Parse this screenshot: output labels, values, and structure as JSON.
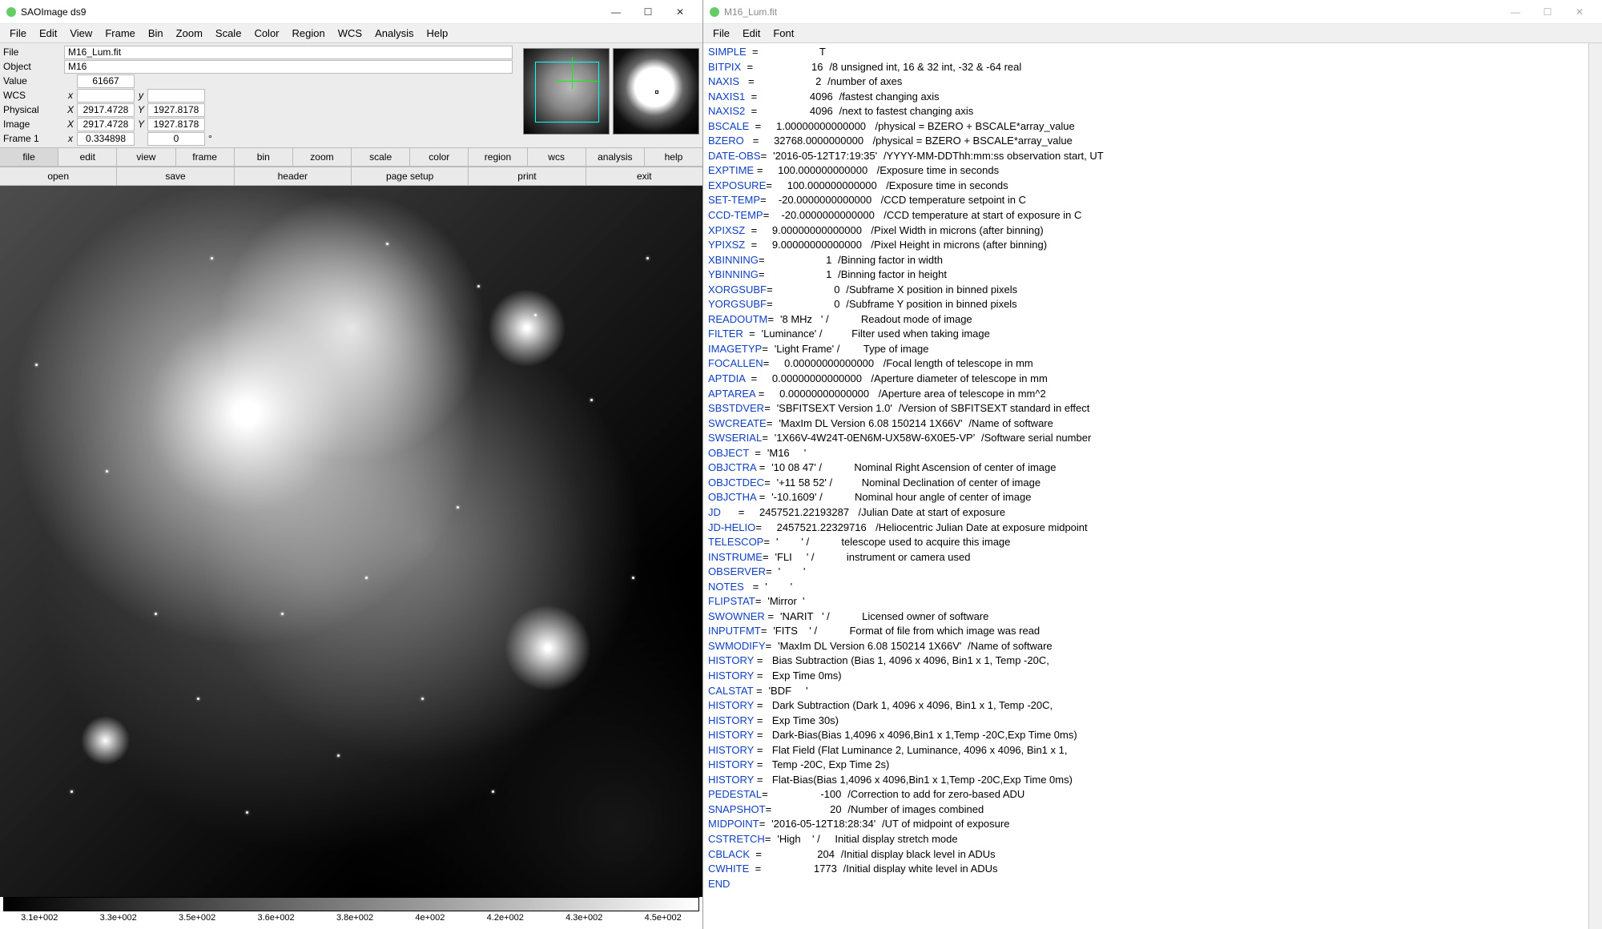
{
  "left_window": {
    "title": "SAOImage ds9",
    "menubar": [
      "File",
      "Edit",
      "View",
      "Frame",
      "Bin",
      "Zoom",
      "Scale",
      "Color",
      "Region",
      "WCS",
      "Analysis",
      "Help"
    ],
    "info": {
      "File": {
        "label": "File",
        "value": "M16_Lum.fit"
      },
      "Object": {
        "label": "Object",
        "value": "M16"
      },
      "Value": {
        "label": "Value",
        "value": "61667"
      },
      "WCS": {
        "label": "WCS",
        "x_lbl": "x",
        "x": "",
        "y_lbl": "y",
        "y": ""
      },
      "Physical": {
        "label": "Physical",
        "x_lbl": "X",
        "x": "2917.4728",
        "y_lbl": "Y",
        "y": "1927.8178"
      },
      "Image": {
        "label": "Image",
        "x_lbl": "X",
        "x": "2917.4728",
        "y_lbl": "Y",
        "y": "1927.8178"
      },
      "Frame": {
        "label": "Frame 1",
        "x_lbl": "x",
        "x": "0.334898",
        "y_lbl": "",
        "y": "0",
        "deg": "°"
      }
    },
    "button_row1": [
      "file",
      "edit",
      "view",
      "frame",
      "bin",
      "zoom",
      "scale",
      "color",
      "region",
      "wcs",
      "analysis",
      "help"
    ],
    "button_row1_active": "file",
    "button_row2": [
      "open",
      "save",
      "header",
      "page setup",
      "print",
      "exit"
    ],
    "colorbar_ticks": [
      "3.1e+002",
      "3.3e+002",
      "3.5e+002",
      "3.6e+002",
      "3.8e+002",
      "4e+002",
      "4.2e+002",
      "4.3e+002",
      "4.5e+002"
    ]
  },
  "right_window": {
    "title": "M16_Lum.fit",
    "menubar": [
      "File",
      "Edit",
      "Font"
    ],
    "header": [
      {
        "k": "SIMPLE  ",
        "v": "                   T",
        "c": ""
      },
      {
        "k": "BITPIX  ",
        "v": "                  16",
        "c": "/8 unsigned int, 16 & 32 int, -32 & -64 real"
      },
      {
        "k": "NAXIS   ",
        "v": "                   2",
        "c": "/number of axes"
      },
      {
        "k": "NAXIS1  ",
        "v": "                4096",
        "c": "/fastest changing axis"
      },
      {
        "k": "NAXIS2  ",
        "v": "                4096",
        "c": "/next to fastest changing axis"
      },
      {
        "k": "BSCALE  ",
        "v": "   1.00000000000000 ",
        "c": "/physical = BZERO + BSCALE*array_value"
      },
      {
        "k": "BZERO   ",
        "v": "   32768.0000000000 ",
        "c": "/physical = BZERO + BSCALE*array_value"
      },
      {
        "k": "DATE-OBS",
        "v": "'2016-05-12T17:19:35'",
        "c": "/YYYY-MM-DDThh:mm:ss observation start, UT"
      },
      {
        "k": "EXPTIME ",
        "v": "   100.000000000000 ",
        "c": "/Exposure time in seconds"
      },
      {
        "k": "EXPOSURE",
        "v": "   100.000000000000 ",
        "c": "/Exposure time in seconds"
      },
      {
        "k": "SET-TEMP",
        "v": "  -20.0000000000000 ",
        "c": "/CCD temperature setpoint in C"
      },
      {
        "k": "CCD-TEMP",
        "v": "  -20.0000000000000 ",
        "c": "/CCD temperature at start of exposure in C"
      },
      {
        "k": "XPIXSZ  ",
        "v": "   9.00000000000000 ",
        "c": "/Pixel Width in microns (after binning)"
      },
      {
        "k": "YPIXSZ  ",
        "v": "   9.00000000000000 ",
        "c": "/Pixel Height in microns (after binning)"
      },
      {
        "k": "XBINNING",
        "v": "                   1",
        "c": "/Binning factor in width"
      },
      {
        "k": "YBINNING",
        "v": "                   1",
        "c": "/Binning factor in height"
      },
      {
        "k": "XORGSUBF",
        "v": "                   0",
        "c": "/Subframe X position in binned pixels"
      },
      {
        "k": "YORGSUBF",
        "v": "                   0",
        "c": "/Subframe Y position in binned pixels"
      },
      {
        "k": "READOUTM",
        "v": "'8 MHz   ' /         ",
        "c": "Readout mode of image"
      },
      {
        "k": "FILTER  ",
        "v": "'Luminance' /        ",
        "c": "Filter used when taking image"
      },
      {
        "k": "IMAGETYP",
        "v": "'Light Frame' /      ",
        "c": "Type of image"
      },
      {
        "k": "FOCALLEN",
        "v": "   0.00000000000000 ",
        "c": "/Focal length of telescope in mm"
      },
      {
        "k": "APTDIA  ",
        "v": "   0.00000000000000 ",
        "c": "/Aperture diameter of telescope in mm"
      },
      {
        "k": "APTAREA ",
        "v": "   0.00000000000000 ",
        "c": "/Aperture area of telescope in mm^2"
      },
      {
        "k": "SBSTDVER",
        "v": "'SBFITSEXT Version 1.0'",
        "c": "/Version of SBFITSEXT standard in effect"
      },
      {
        "k": "SWCREATE",
        "v": "'MaxIm DL Version 6.08 150214 1X66V'",
        "c": "/Name of software"
      },
      {
        "k": "SWSERIAL",
        "v": "'1X66V-4W24T-0EN6M-UX58W-6X0E5-VP'",
        "c": "/Software serial number"
      },
      {
        "k": "OBJECT  ",
        "v": "'M16     '",
        "c": ""
      },
      {
        "k": "OBJCTRA ",
        "v": "'10 08 47' /         ",
        "c": "Nominal Right Ascension of center of image"
      },
      {
        "k": "OBJCTDEC",
        "v": "'+11 58 52' /        ",
        "c": "Nominal Declination of center of image"
      },
      {
        "k": "OBJCTHA ",
        "v": "'-10.1609' /         ",
        "c": "Nominal hour angle of center of image"
      },
      {
        "k": "JD      ",
        "v": "   2457521.22193287 ",
        "c": "/Julian Date at start of exposure"
      },
      {
        "k": "JD-HELIO",
        "v": "   2457521.22329716 ",
        "c": "/Heliocentric Julian Date at exposure midpoint"
      },
      {
        "k": "TELESCOP",
        "v": "'        ' /         ",
        "c": "telescope used to acquire this image"
      },
      {
        "k": "INSTRUME",
        "v": "'FLI     ' /         ",
        "c": "instrument or camera used"
      },
      {
        "k": "OBSERVER",
        "v": "'        '",
        "c": ""
      },
      {
        "k": "NOTES   ",
        "v": "'        '",
        "c": ""
      },
      {
        "k": "FLIPSTAT",
        "v": "'Mirror  '",
        "c": ""
      },
      {
        "k": "SWOWNER ",
        "v": "'NARIT   ' /         ",
        "c": "Licensed owner of software"
      },
      {
        "k": "INPUTFMT",
        "v": "'FITS    ' /         ",
        "c": "Format of file from which image was read"
      },
      {
        "k": "SWMODIFY",
        "v": "'MaxIm DL Version 6.08 150214 1X66V'",
        "c": "/Name of software"
      },
      {
        "k": "HISTORY ",
        "v": " Bias Subtraction (Bias 1, 4096 x 4096, Bin1 x 1, Temp -20C,",
        "c": ""
      },
      {
        "k": "HISTORY ",
        "v": " Exp Time 0ms)",
        "c": ""
      },
      {
        "k": "CALSTAT ",
        "v": "'BDF     '",
        "c": ""
      },
      {
        "k": "HISTORY ",
        "v": " Dark Subtraction (Dark 1, 4096 x 4096, Bin1 x 1, Temp -20C,",
        "c": ""
      },
      {
        "k": "HISTORY ",
        "v": " Exp Time 30s)",
        "c": ""
      },
      {
        "k": "HISTORY ",
        "v": " Dark-Bias(Bias 1,4096 x 4096,Bin1 x 1,Temp -20C,Exp Time 0ms)",
        "c": ""
      },
      {
        "k": "HISTORY ",
        "v": " Flat Field (Flat Luminance 2, Luminance, 4096 x 4096, Bin1 x 1,",
        "c": ""
      },
      {
        "k": "HISTORY ",
        "v": " Temp -20C, Exp Time 2s)",
        "c": ""
      },
      {
        "k": "HISTORY ",
        "v": " Flat-Bias(Bias 1,4096 x 4096,Bin1 x 1,Temp -20C,Exp Time 0ms)",
        "c": ""
      },
      {
        "k": "PEDESTAL",
        "v": "                -100",
        "c": "/Correction to add for zero-based ADU"
      },
      {
        "k": "SNAPSHOT",
        "v": "                  20",
        "c": "/Number of images combined"
      },
      {
        "k": "MIDPOINT",
        "v": "'2016-05-12T18:28:34'",
        "c": "/UT of midpoint of exposure"
      },
      {
        "k": "CSTRETCH",
        "v": "'High    ' /   ",
        "c": "Initial display stretch mode"
      },
      {
        "k": "CBLACK  ",
        "v": "                 204",
        "c": "/Initial display black level in ADUs"
      },
      {
        "k": "CWHITE  ",
        "v": "                1773",
        "c": "/Initial display white level in ADUs"
      },
      {
        "k": "END",
        "v": "",
        "c": ""
      }
    ]
  }
}
